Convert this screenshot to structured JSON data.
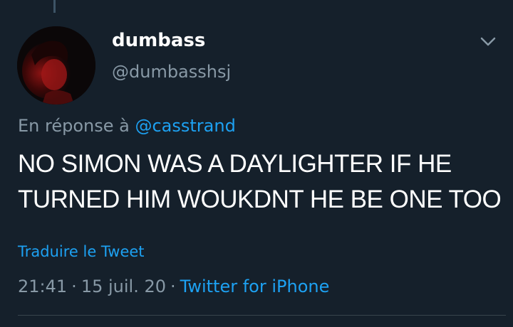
{
  "tweet": {
    "author": {
      "display_name": "dumbass",
      "handle": "@dumbasshsj"
    },
    "reply_prefix": "En réponse à",
    "reply_to": "@casstrand",
    "text_lines": [
      "NO SIMON WAS A DAYLIGHTER IF HE",
      "TURNED HIM WOUKDNT HE BE ONE TOO"
    ],
    "translate_label": "Traduire le Tweet",
    "time": "21:41",
    "separator": "·",
    "date": "15 juil. 20",
    "source": "Twitter for iPhone"
  },
  "icons": {
    "menu": "chevron-down-icon",
    "avatar": "avatar"
  },
  "colors": {
    "background": "#15202b",
    "text_primary": "#ffffff",
    "text_secondary": "#8899a6",
    "accent": "#1da1f2",
    "divider": "#38444d"
  }
}
